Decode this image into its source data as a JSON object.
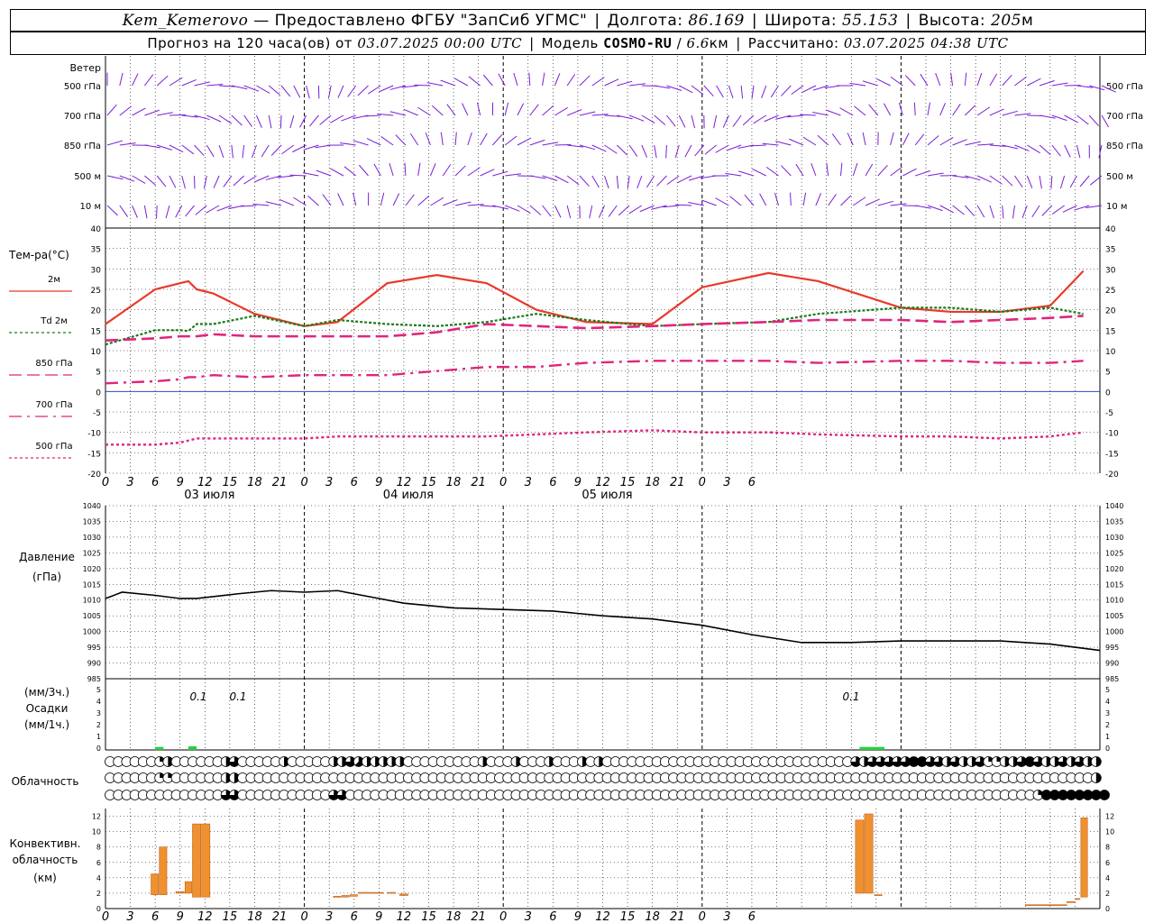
{
  "header": {
    "station": "Kem_Kemerovo",
    "provider": "— Предоставлено ФГБУ \"ЗапСиб УГМС\"",
    "lon_label": "Долгота:",
    "lon": "86.169",
    "lat_label": "Широта:",
    "lat": "55.153",
    "alt_label": "Высота:",
    "alt": "205",
    "alt_unit": "м",
    "forecast_label": "Прогноз на 120 часа(ов) от",
    "forecast_time": "03.07.2025 00:00 UTC",
    "model_label": "Модель",
    "model": "COSMO-RU",
    "model_res": "6.6",
    "model_res_unit": "км",
    "calc_label": "Рассчитано:",
    "calc_time": "03.07.2025 04:38 UTC"
  },
  "axis": {
    "hour_ticks": [
      "0",
      "3",
      "6",
      "9",
      "12",
      "15",
      "18",
      "21",
      "0",
      "3",
      "6",
      "9",
      "12",
      "15",
      "18",
      "21",
      "0",
      "3",
      "6",
      "9",
      "12",
      "15",
      "18",
      "21",
      "0",
      "3",
      "6"
    ],
    "dates": [
      "03 июля",
      "04 июля",
      "05 июля"
    ]
  },
  "wind": {
    "title": "Ветер",
    "levels": [
      "500 гПа",
      "700 гПа",
      "850 гПа",
      "500 м",
      "10 м"
    ],
    "colors": {
      "barb": "#7a1fd6"
    }
  },
  "temperature": {
    "title": "Тем-ра(°С)",
    "ylim": [
      -20,
      40
    ],
    "yticks": [
      "40",
      "35",
      "30",
      "25",
      "20",
      "15",
      "10",
      "5",
      "0",
      "-5",
      "-10",
      "-15",
      "-20"
    ],
    "legend": [
      {
        "label": "2м",
        "color": "#e8392b"
      },
      {
        "label": "Td  2м",
        "color": "#1a7a1a"
      },
      {
        "label": "850 гПа",
        "color": "#e0257d"
      },
      {
        "label": "700 гПа",
        "color": "#e0257d"
      },
      {
        "label": "500 гПа",
        "color": "#e0257d"
      }
    ]
  },
  "pressure": {
    "title": "Давление",
    "unit": "(гПа)",
    "ylim": [
      985,
      1040
    ],
    "yticks": [
      "1040",
      "1035",
      "1030",
      "1025",
      "1020",
      "1015",
      "1010",
      "1005",
      "1000",
      "995",
      "990",
      "985"
    ]
  },
  "precip": {
    "unit1": "(мм/3ч.)",
    "title": "Осадки",
    "unit2": "(мм/1ч.)",
    "yticks": [
      "5",
      "4",
      "3",
      "2",
      "1",
      "0"
    ],
    "labels": [
      "0.1",
      "0.1",
      "0.1"
    ]
  },
  "cloud": {
    "title": "Облачность"
  },
  "convective": {
    "title1": "Конвективн.",
    "title2": "облачность",
    "unit": "(км)",
    "yticks": [
      "12",
      "10",
      "8",
      "6",
      "4",
      "2",
      "0"
    ]
  },
  "chart_data": [
    {
      "type": "line",
      "name": "temperature",
      "x_hours": [
        0,
        6,
        9,
        10,
        11,
        13,
        18,
        24,
        28,
        34,
        40,
        46,
        52,
        58,
        66,
        72,
        80,
        86,
        96,
        102,
        108,
        114,
        118
      ],
      "series": [
        {
          "name": "2м",
          "color": "#e8392b",
          "values": [
            16.5,
            25,
            26.5,
            27,
            25,
            24,
            19,
            16,
            17,
            26.5,
            28.5,
            26.5,
            20,
            17,
            16.5,
            25.5,
            29,
            27,
            20.5,
            19.5,
            19.5,
            21,
            29.5
          ]
        },
        {
          "name": "Td  2м",
          "color": "#1a7a1a",
          "values": [
            11.5,
            15,
            15,
            14.8,
            16.5,
            16.5,
            18.5,
            16,
            17.5,
            16.5,
            16,
            17,
            19,
            17.5,
            16,
            16.5,
            17,
            19,
            20.5,
            20.5,
            19.5,
            20.5,
            19
          ]
        },
        {
          "name": "850 гПа",
          "color": "#e0257d",
          "values": [
            12.5,
            13,
            13.5,
            13.5,
            13.5,
            14,
            13.5,
            13.5,
            13.5,
            13.5,
            14.5,
            16.5,
            16,
            15.5,
            16,
            16.5,
            17,
            17.5,
            17.5,
            17,
            17.5,
            18,
            18.5
          ]
        },
        {
          "name": "700 гПа",
          "color": "#e0257d",
          "values": [
            2,
            2.5,
            3,
            3.5,
            3.5,
            4,
            3.5,
            4,
            4,
            4,
            5,
            6,
            6,
            7,
            7.5,
            7.5,
            7.5,
            7,
            7.5,
            7.5,
            7,
            7,
            7.5
          ]
        },
        {
          "name": "500 гПа",
          "color": "#e0257d",
          "values": [
            -13,
            -13,
            -12.5,
            -12,
            -11.5,
            -11.5,
            -11.5,
            -11.5,
            -11,
            -11,
            -11,
            -11,
            -10.5,
            -10,
            -9.5,
            -10,
            -10,
            -10.5,
            -11,
            -11,
            -11.5,
            -11,
            -10
          ]
        }
      ]
    },
    {
      "type": "line",
      "name": "pressure",
      "x_hours": [
        0,
        2,
        6,
        9,
        11,
        16,
        20,
        24,
        28,
        32,
        36,
        42,
        48,
        54,
        60,
        66,
        72,
        78,
        84,
        90,
        96,
        102,
        108,
        114,
        120
      ],
      "series": [
        {
          "color": "#000000",
          "values": [
            1010.5,
            1012.5,
            1011.5,
            1010.5,
            1010.5,
            1012,
            1013,
            1012.5,
            1013,
            1011,
            1009,
            1007.5,
            1007,
            1006.5,
            1005,
            1004,
            1002,
            999,
            996.5,
            996.5,
            997,
            997,
            997,
            996,
            994
          ]
        }
      ]
    },
    {
      "type": "bar",
      "name": "precipitation",
      "unit": "мм",
      "bars": [
        {
          "start": 6,
          "end": 7,
          "value": 0.1,
          "color": "#2ecc40"
        },
        {
          "start": 10,
          "end": 11,
          "value": 0.15,
          "color": "#2ecc40"
        },
        {
          "start": 91,
          "end": 94,
          "value": 0.1,
          "color": "#2ecc40"
        }
      ]
    },
    {
      "type": "bar",
      "name": "convective_cloud_km",
      "bars": [
        {
          "start": 5.5,
          "end": 6.4,
          "base": 1.8,
          "top": 4.5
        },
        {
          "start": 6.5,
          "end": 7.4,
          "base": 1.8,
          "top": 8
        },
        {
          "start": 8.5,
          "end": 9.5,
          "base": 2,
          "top": 2.2
        },
        {
          "start": 9.6,
          "end": 10.4,
          "base": 2,
          "top": 3.5
        },
        {
          "start": 10.5,
          "end": 11.5,
          "base": 1.5,
          "top": 11
        },
        {
          "start": 11.6,
          "end": 12.6,
          "base": 1.5,
          "top": 11
        },
        {
          "start": 27.5,
          "end": 28.4,
          "base": 1.5,
          "top": 1.6
        },
        {
          "start": 28.5,
          "end": 29.4,
          "base": 1.5,
          "top": 1.7
        },
        {
          "start": 29.5,
          "end": 30.4,
          "base": 1.6,
          "top": 1.8
        },
        {
          "start": 30.5,
          "end": 33.5,
          "base": 2,
          "top": 2.1
        },
        {
          "start": 34,
          "end": 35,
          "base": 2,
          "top": 2.1
        },
        {
          "start": 35.5,
          "end": 36.5,
          "base": 1.7,
          "top": 1.9
        },
        {
          "start": 90.5,
          "end": 91.5,
          "base": 2,
          "top": 11.5
        },
        {
          "start": 91.6,
          "end": 92.6,
          "base": 2,
          "top": 12.3
        },
        {
          "start": 92.8,
          "end": 93.7,
          "base": 1.7,
          "top": 1.8
        },
        {
          "start": 111,
          "end": 116,
          "base": 0.4,
          "top": 0.5
        },
        {
          "start": 116,
          "end": 117,
          "base": 0.8,
          "top": 0.9
        },
        {
          "start": 117,
          "end": 117.6,
          "base": 1.2,
          "top": 1.3
        },
        {
          "start": 117.7,
          "end": 118.5,
          "base": 1.5,
          "top": 11.8
        }
      ]
    },
    {
      "type": "table",
      "name": "cloudiness_octants",
      "description_rows": [
        "high",
        "middle",
        "low"
      ],
      "step_hours": 1,
      "rows": [
        [
          0,
          0,
          0,
          0,
          0,
          0,
          2,
          4,
          0,
          0,
          0,
          0,
          0,
          0,
          4,
          6,
          0,
          0,
          0,
          0,
          0,
          4,
          0,
          0,
          0,
          0,
          0,
          4,
          4,
          6,
          5,
          4,
          4,
          4,
          4,
          4,
          0,
          0,
          0,
          0,
          0,
          0,
          0,
          0,
          0,
          4,
          0,
          0,
          0,
          4,
          0,
          0,
          0,
          4,
          0,
          0,
          0,
          4,
          0,
          4,
          0,
          0,
          0,
          0,
          0,
          0,
          0,
          0,
          0,
          0,
          0,
          0,
          0,
          0,
          0,
          0,
          0,
          0,
          0,
          0,
          0,
          0,
          0,
          0,
          0,
          0,
          0,
          0,
          0,
          0,
          6,
          4,
          6,
          6,
          6,
          6,
          6,
          8,
          8,
          6,
          6,
          4,
          6,
          4,
          4,
          6,
          2,
          2,
          4,
          4,
          6,
          8,
          6,
          4,
          4,
          6,
          4,
          6,
          4,
          4
        ],
        [
          0,
          0,
          0,
          0,
          0,
          0,
          2,
          2,
          0,
          0,
          0,
          0,
          0,
          0,
          4,
          4,
          0,
          0,
          0,
          0,
          0,
          0,
          0,
          0,
          0,
          0,
          0,
          0,
          0,
          0,
          0,
          0,
          0,
          0,
          0,
          0,
          0,
          0,
          0,
          0,
          0,
          0,
          0,
          0,
          0,
          0,
          0,
          0,
          0,
          0,
          0,
          0,
          0,
          0,
          0,
          0,
          0,
          0,
          0,
          0,
          0,
          0,
          0,
          0,
          0,
          0,
          0,
          0,
          0,
          0,
          0,
          0,
          0,
          0,
          0,
          0,
          0,
          0,
          0,
          0,
          0,
          0,
          0,
          0,
          0,
          0,
          0,
          0,
          0,
          0,
          0,
          0,
          0,
          0,
          0,
          0,
          0,
          0,
          0,
          0,
          0,
          0,
          0,
          0,
          0,
          0,
          0,
          0,
          0,
          0,
          0,
          0,
          0,
          0,
          0,
          0,
          0,
          0,
          0,
          4
        ],
        [
          0,
          0,
          0,
          0,
          0,
          0,
          0,
          0,
          0,
          0,
          0,
          0,
          0,
          0,
          6,
          6,
          0,
          0,
          0,
          0,
          0,
          0,
          0,
          0,
          0,
          0,
          0,
          6,
          6,
          0,
          0,
          0,
          0,
          0,
          0,
          0,
          0,
          0,
          0,
          0,
          0,
          0,
          0,
          0,
          0,
          0,
          0,
          0,
          0,
          0,
          0,
          0,
          0,
          0,
          0,
          0,
          0,
          0,
          0,
          0,
          0,
          0,
          0,
          0,
          0,
          0,
          0,
          0,
          0,
          0,
          0,
          0,
          0,
          0,
          0,
          0,
          0,
          0,
          0,
          0,
          0,
          0,
          0,
          0,
          0,
          0,
          0,
          0,
          0,
          0,
          0,
          0,
          0,
          0,
          0,
          0,
          0,
          0,
          0,
          0,
          0,
          0,
          0,
          0,
          0,
          0,
          0,
          0,
          0,
          0,
          0,
          0,
          2,
          8,
          8,
          8,
          8,
          8,
          8,
          8,
          8,
          8,
          8,
          8,
          8,
          0,
          0,
          0,
          4
        ]
      ]
    }
  ]
}
